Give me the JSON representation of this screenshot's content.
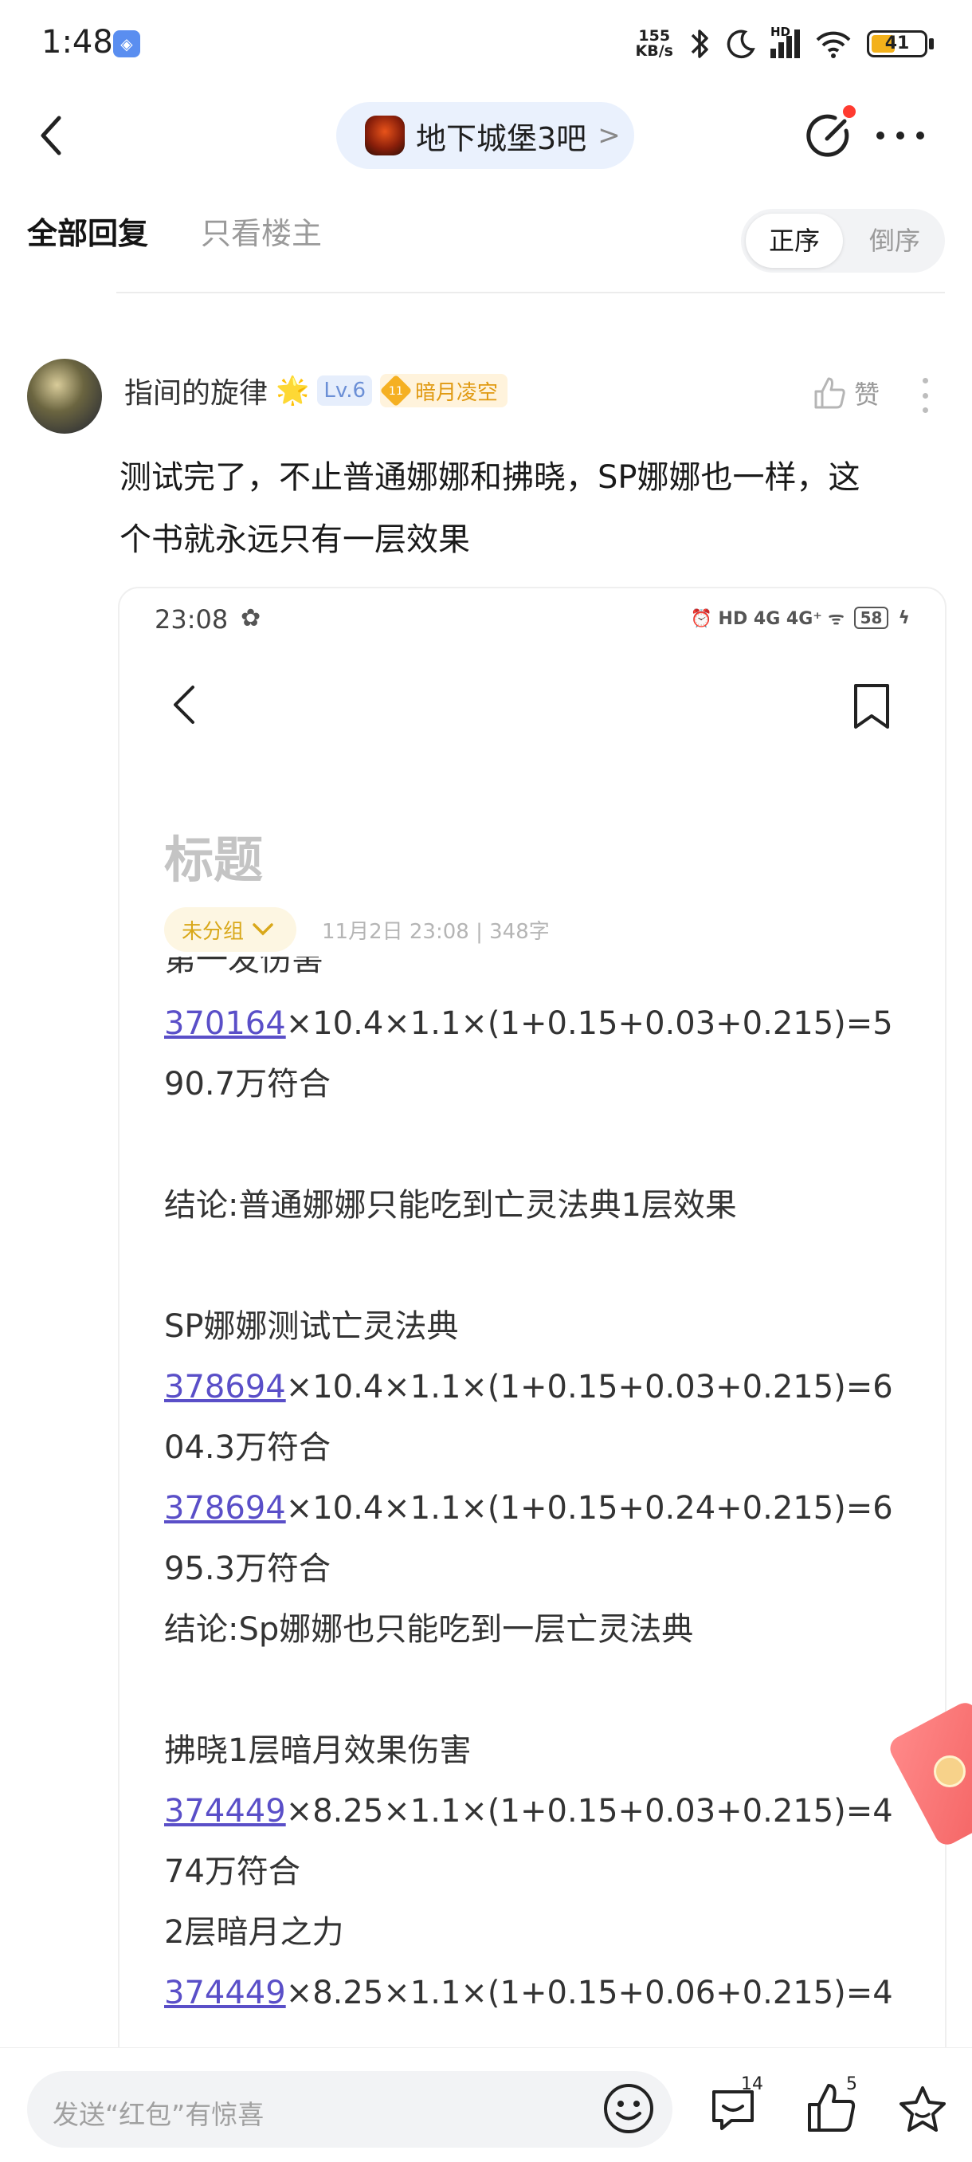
{
  "status_bar": {
    "time": "1:48",
    "net_speed_top": "155",
    "net_speed_bottom": "KB/s",
    "hd_label": "HD",
    "battery": "41"
  },
  "header": {
    "forum_name": "地下城堡3吧",
    "forum_chevron": ">"
  },
  "tabs": {
    "all_replies": "全部回复",
    "op_only": "只看楼主",
    "order_asc": "正序",
    "order_desc": "倒序"
  },
  "post": {
    "username": "指间的旋律",
    "user_emoji": "🌟",
    "level": "Lv.6",
    "medal_level": "11",
    "medal_name": "暗月凌空",
    "like_label": "赞",
    "text_line1": "测试完了，不止普通娜娜和拂晓，SP娜娜也一样，这",
    "text_line2": "个书就永远只有一层效果"
  },
  "embedded_screenshot": {
    "time": "23:08",
    "status_icons": "⏰ HD 4G 4G⁺ ᯤ",
    "battery": "58",
    "title": "标题",
    "group_label": "未分组",
    "meta": "11月2日 23:08  |  348字",
    "cut_line": "第一发伤害",
    "lines": [
      {
        "link": "370164",
        "rest": "×10.4×1.1×(1+0.15+0.03+0.215)=5"
      },
      {
        "link": "",
        "rest": "90.7万符合"
      },
      {
        "link": "",
        "rest": ""
      },
      {
        "link": "",
        "rest": "结论:普通娜娜只能吃到亡灵法典1层效果"
      },
      {
        "link": "",
        "rest": ""
      },
      {
        "link": "",
        "rest": "SP娜娜测试亡灵法典"
      },
      {
        "link": "378694",
        "rest": "×10.4×1.1×(1+0.15+0.03+0.215)=6"
      },
      {
        "link": "",
        "rest": "04.3万符合"
      },
      {
        "link": "378694",
        "rest": "×10.4×1.1×(1+0.15+0.24+0.215)=6"
      },
      {
        "link": "",
        "rest": "95.3万符合"
      },
      {
        "link": "",
        "rest": "结论:Sp娜娜也只能吃到一层亡灵法典"
      },
      {
        "link": "",
        "rest": ""
      },
      {
        "link": "",
        "rest": "拂晓1层暗月效果伤害"
      },
      {
        "link": "374449",
        "rest": "×8.25×1.1×(1+0.15+0.03+0.215)=4"
      },
      {
        "link": "",
        "rest": "74万符合"
      },
      {
        "link": "",
        "rest": "2层暗月之力"
      },
      {
        "link": "374449",
        "rest": "×8.25×1.1×(1+0.15+0.06+0.215)=4"
      }
    ]
  },
  "bottom_bar": {
    "reply_placeholder": "发送“红包”有惊喜",
    "comment_count": "14",
    "like_count": "5"
  },
  "colors": {
    "accent_blue": "#eaf1fd",
    "link_purple": "#5a4fc8",
    "medal_gold": "#f5b022",
    "red_dot": "#ff3b30"
  }
}
